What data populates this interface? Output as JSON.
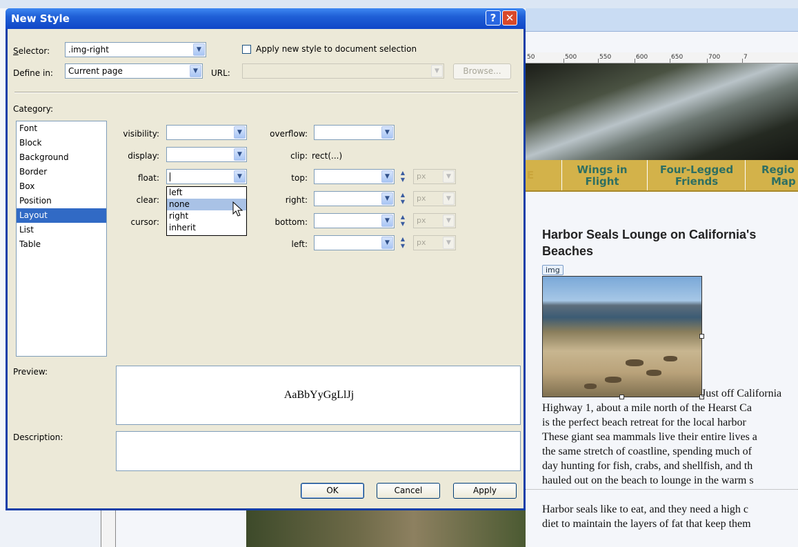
{
  "dialog": {
    "title": "New Style",
    "help_label": "?",
    "close_label": "✕",
    "selector_label": "Selector:",
    "selector_value": ".img-right",
    "apply_checkbox_label": "Apply new style to document selection",
    "define_in_label": "Define in:",
    "define_in_value": "Current page",
    "url_label": "URL:",
    "browse_label": "Browse...",
    "category_label": "Category:",
    "categories": [
      "Font",
      "Block",
      "Background",
      "Border",
      "Box",
      "Position",
      "Layout",
      "List",
      "Table"
    ],
    "selected_category": "Layout",
    "layout": {
      "visibility_label": "visibility:",
      "display_label": "display:",
      "float_label": "float:",
      "clear_label": "clear:",
      "cursor_label": "cursor:",
      "overflow_label": "overflow:",
      "clip_label": "clip:",
      "clip_value": "rect(...)",
      "top_label": "top:",
      "right_label": "right:",
      "bottom_label": "bottom:",
      "left_label": "left:",
      "unit": "px"
    },
    "float_options": [
      "left",
      "none",
      "right",
      "inherit"
    ],
    "float_highlighted": "none",
    "preview_label": "Preview:",
    "preview_text": "AaBbYyGgLlJj",
    "description_label": "Description:",
    "ok_label": "OK",
    "cancel_label": "Cancel",
    "apply_label": "Apply"
  },
  "page": {
    "ruler_ticks": [
      "50",
      "500",
      "550",
      "600",
      "650",
      "700",
      "7"
    ],
    "nav": {
      "partial_left": "E",
      "item1_line1": "Wings in",
      "item1_line2": "Flight",
      "item2_line1": "Four-Legged",
      "item2_line2": "Friends",
      "item3_line1": "Regio",
      "item3_line2": "Map"
    },
    "article_title_line1": "Harbor Seals Lounge on California's",
    "article_title_line2": "Beaches",
    "img_tag": "img",
    "body_lines": [
      "Just off California",
      "Highway 1, about a mile north of the Hearst Ca",
      "is the perfect beach retreat for the local harbor",
      "These giant sea mammals live their entire lives a",
      "the same stretch of coastline, spending much of",
      "day hunting for fish, crabs, and shellfish, and th",
      "hauled out on the beach to lounge in the warm s"
    ],
    "body2_line1": "Harbor seals like to eat, and they need a high c",
    "body2_line2": "diet to maintain the layers of fat that keep them"
  },
  "colors": {
    "title_bar": "#1f5fd6",
    "selection": "#316ac5",
    "nav_bg": "#d3b24a",
    "nav_text": "#2e6f62"
  }
}
